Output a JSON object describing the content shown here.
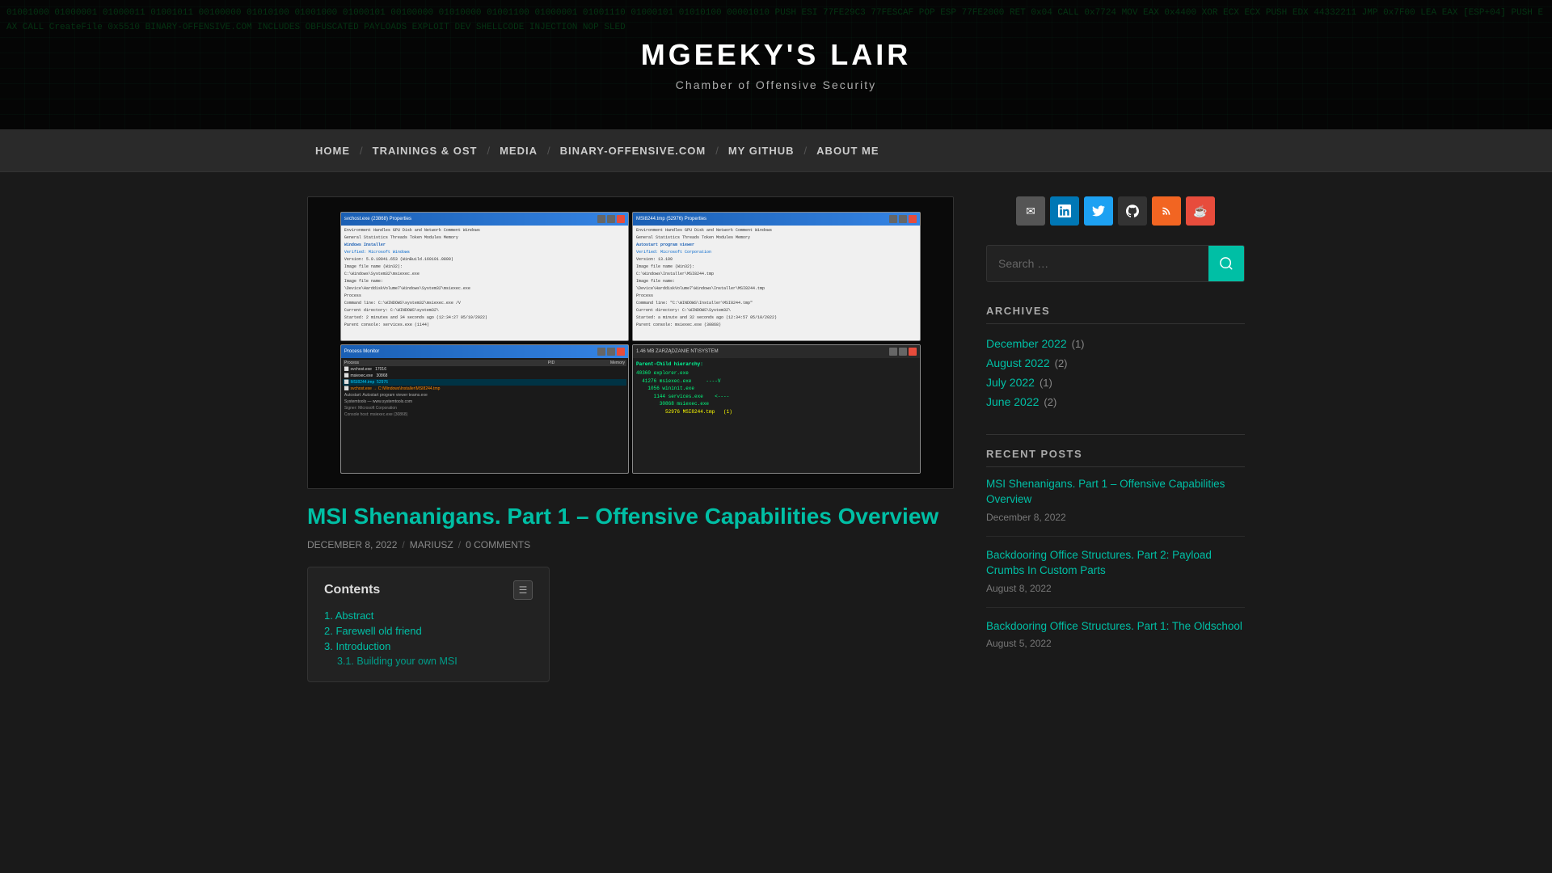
{
  "site": {
    "title": "MGEEKY'S LAIR",
    "subtitle": "Chamber of Offensive Security"
  },
  "nav": {
    "items": [
      {
        "label": "HOME",
        "id": "home"
      },
      {
        "label": "TRAININGS & OST",
        "id": "trainings"
      },
      {
        "label": "MEDIA",
        "id": "media"
      },
      {
        "label": "BINARY-OFFENSIVE.COM",
        "id": "binary"
      },
      {
        "label": "MY GITHUB",
        "id": "github"
      },
      {
        "label": "ABOUT ME",
        "id": "about"
      }
    ]
  },
  "post": {
    "title": "MSI Shenanigans. Part 1 – Offensive Capabilities Overview",
    "date": "DECEMBER 8, 2022",
    "author": "MARIUSZ",
    "comments": "0 COMMENTS",
    "toc": {
      "title": "Contents",
      "items": [
        {
          "label": "1. Abstract",
          "indent": 0
        },
        {
          "label": "2. Farewell old friend",
          "indent": 0
        },
        {
          "label": "3. Introduction",
          "indent": 0
        },
        {
          "label": "3.1. Building your own MSI",
          "indent": 1
        }
      ]
    }
  },
  "sidebar": {
    "search": {
      "placeholder": "Search …"
    },
    "social": [
      {
        "id": "email",
        "label": "email-icon",
        "symbol": "✉"
      },
      {
        "id": "linkedin",
        "label": "linkedin-icon",
        "symbol": "in"
      },
      {
        "id": "twitter",
        "label": "twitter-icon",
        "symbol": "🐦"
      },
      {
        "id": "github",
        "label": "github-icon",
        "symbol": "⌥"
      },
      {
        "id": "rss",
        "label": "rss-icon",
        "symbol": "⌂"
      },
      {
        "id": "kofi",
        "label": "kofi-icon",
        "symbol": "☕"
      }
    ],
    "archives": {
      "title": "ARCHIVES",
      "items": [
        {
          "label": "December 2022",
          "count": 1
        },
        {
          "label": "August 2022",
          "count": 2
        },
        {
          "label": "July 2022",
          "count": 1
        },
        {
          "label": "June 2022",
          "count": 2
        }
      ]
    },
    "recent_posts": {
      "title": "RECENT POSTS",
      "items": [
        {
          "title": "MSI Shenanigans. Part 1 – Offensive Capabilities Overview",
          "date": "December 8, 2022"
        },
        {
          "title": "Backdooring Office Structures. Part 2: Payload Crumbs In Custom Parts",
          "date": "August 8, 2022"
        },
        {
          "title": "Backdooring Office Structures. Part 1: The Oldschool",
          "date": "August 5, 2022"
        }
      ]
    }
  },
  "screenshot": {
    "panel1_title": "svchost.exe (23868) Properties",
    "panel2_title": "MSI8244.tmp (52976) Properties",
    "hierarchy_label": "Parent-Child hierarchy:",
    "hierarchy_lines": [
      "40360 explorer.exe",
      "  41276 msiexec.exe    ----V",
      "    1056 wininit.exe",
      "      1144 services.exe   <----",
      "        30868 msiexec.exe",
      "          52976 MSI8244.tmp   (1)"
    ]
  }
}
